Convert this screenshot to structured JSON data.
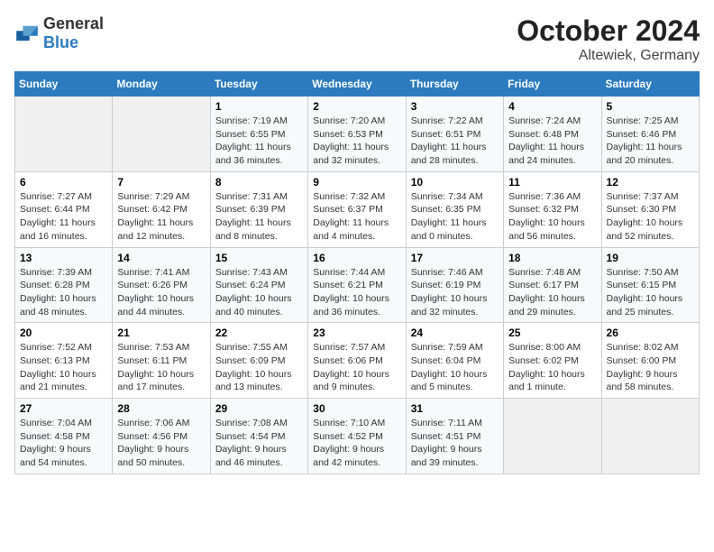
{
  "logo": {
    "general": "General",
    "blue": "Blue"
  },
  "header": {
    "month": "October 2024",
    "location": "Altewiek, Germany"
  },
  "columns": [
    "Sunday",
    "Monday",
    "Tuesday",
    "Wednesday",
    "Thursday",
    "Friday",
    "Saturday"
  ],
  "weeks": [
    [
      {
        "day": "",
        "empty": true
      },
      {
        "day": "",
        "empty": true
      },
      {
        "day": "1",
        "sunrise": "Sunrise: 7:19 AM",
        "sunset": "Sunset: 6:55 PM",
        "daylight": "Daylight: 11 hours and 36 minutes."
      },
      {
        "day": "2",
        "sunrise": "Sunrise: 7:20 AM",
        "sunset": "Sunset: 6:53 PM",
        "daylight": "Daylight: 11 hours and 32 minutes."
      },
      {
        "day": "3",
        "sunrise": "Sunrise: 7:22 AM",
        "sunset": "Sunset: 6:51 PM",
        "daylight": "Daylight: 11 hours and 28 minutes."
      },
      {
        "day": "4",
        "sunrise": "Sunrise: 7:24 AM",
        "sunset": "Sunset: 6:48 PM",
        "daylight": "Daylight: 11 hours and 24 minutes."
      },
      {
        "day": "5",
        "sunrise": "Sunrise: 7:25 AM",
        "sunset": "Sunset: 6:46 PM",
        "daylight": "Daylight: 11 hours and 20 minutes."
      }
    ],
    [
      {
        "day": "6",
        "sunrise": "Sunrise: 7:27 AM",
        "sunset": "Sunset: 6:44 PM",
        "daylight": "Daylight: 11 hours and 16 minutes."
      },
      {
        "day": "7",
        "sunrise": "Sunrise: 7:29 AM",
        "sunset": "Sunset: 6:42 PM",
        "daylight": "Daylight: 11 hours and 12 minutes."
      },
      {
        "day": "8",
        "sunrise": "Sunrise: 7:31 AM",
        "sunset": "Sunset: 6:39 PM",
        "daylight": "Daylight: 11 hours and 8 minutes."
      },
      {
        "day": "9",
        "sunrise": "Sunrise: 7:32 AM",
        "sunset": "Sunset: 6:37 PM",
        "daylight": "Daylight: 11 hours and 4 minutes."
      },
      {
        "day": "10",
        "sunrise": "Sunrise: 7:34 AM",
        "sunset": "Sunset: 6:35 PM",
        "daylight": "Daylight: 11 hours and 0 minutes."
      },
      {
        "day": "11",
        "sunrise": "Sunrise: 7:36 AM",
        "sunset": "Sunset: 6:32 PM",
        "daylight": "Daylight: 10 hours and 56 minutes."
      },
      {
        "day": "12",
        "sunrise": "Sunrise: 7:37 AM",
        "sunset": "Sunset: 6:30 PM",
        "daylight": "Daylight: 10 hours and 52 minutes."
      }
    ],
    [
      {
        "day": "13",
        "sunrise": "Sunrise: 7:39 AM",
        "sunset": "Sunset: 6:28 PM",
        "daylight": "Daylight: 10 hours and 48 minutes."
      },
      {
        "day": "14",
        "sunrise": "Sunrise: 7:41 AM",
        "sunset": "Sunset: 6:26 PM",
        "daylight": "Daylight: 10 hours and 44 minutes."
      },
      {
        "day": "15",
        "sunrise": "Sunrise: 7:43 AM",
        "sunset": "Sunset: 6:24 PM",
        "daylight": "Daylight: 10 hours and 40 minutes."
      },
      {
        "day": "16",
        "sunrise": "Sunrise: 7:44 AM",
        "sunset": "Sunset: 6:21 PM",
        "daylight": "Daylight: 10 hours and 36 minutes."
      },
      {
        "day": "17",
        "sunrise": "Sunrise: 7:46 AM",
        "sunset": "Sunset: 6:19 PM",
        "daylight": "Daylight: 10 hours and 32 minutes."
      },
      {
        "day": "18",
        "sunrise": "Sunrise: 7:48 AM",
        "sunset": "Sunset: 6:17 PM",
        "daylight": "Daylight: 10 hours and 29 minutes."
      },
      {
        "day": "19",
        "sunrise": "Sunrise: 7:50 AM",
        "sunset": "Sunset: 6:15 PM",
        "daylight": "Daylight: 10 hours and 25 minutes."
      }
    ],
    [
      {
        "day": "20",
        "sunrise": "Sunrise: 7:52 AM",
        "sunset": "Sunset: 6:13 PM",
        "daylight": "Daylight: 10 hours and 21 minutes."
      },
      {
        "day": "21",
        "sunrise": "Sunrise: 7:53 AM",
        "sunset": "Sunset: 6:11 PM",
        "daylight": "Daylight: 10 hours and 17 minutes."
      },
      {
        "day": "22",
        "sunrise": "Sunrise: 7:55 AM",
        "sunset": "Sunset: 6:09 PM",
        "daylight": "Daylight: 10 hours and 13 minutes."
      },
      {
        "day": "23",
        "sunrise": "Sunrise: 7:57 AM",
        "sunset": "Sunset: 6:06 PM",
        "daylight": "Daylight: 10 hours and 9 minutes."
      },
      {
        "day": "24",
        "sunrise": "Sunrise: 7:59 AM",
        "sunset": "Sunset: 6:04 PM",
        "daylight": "Daylight: 10 hours and 5 minutes."
      },
      {
        "day": "25",
        "sunrise": "Sunrise: 8:00 AM",
        "sunset": "Sunset: 6:02 PM",
        "daylight": "Daylight: 10 hours and 1 minute."
      },
      {
        "day": "26",
        "sunrise": "Sunrise: 8:02 AM",
        "sunset": "Sunset: 6:00 PM",
        "daylight": "Daylight: 9 hours and 58 minutes."
      }
    ],
    [
      {
        "day": "27",
        "sunrise": "Sunrise: 7:04 AM",
        "sunset": "Sunset: 4:58 PM",
        "daylight": "Daylight: 9 hours and 54 minutes."
      },
      {
        "day": "28",
        "sunrise": "Sunrise: 7:06 AM",
        "sunset": "Sunset: 4:56 PM",
        "daylight": "Daylight: 9 hours and 50 minutes."
      },
      {
        "day": "29",
        "sunrise": "Sunrise: 7:08 AM",
        "sunset": "Sunset: 4:54 PM",
        "daylight": "Daylight: 9 hours and 46 minutes."
      },
      {
        "day": "30",
        "sunrise": "Sunrise: 7:10 AM",
        "sunset": "Sunset: 4:52 PM",
        "daylight": "Daylight: 9 hours and 42 minutes."
      },
      {
        "day": "31",
        "sunrise": "Sunrise: 7:11 AM",
        "sunset": "Sunset: 4:51 PM",
        "daylight": "Daylight: 9 hours and 39 minutes."
      },
      {
        "day": "",
        "empty": true
      },
      {
        "day": "",
        "empty": true
      }
    ]
  ]
}
